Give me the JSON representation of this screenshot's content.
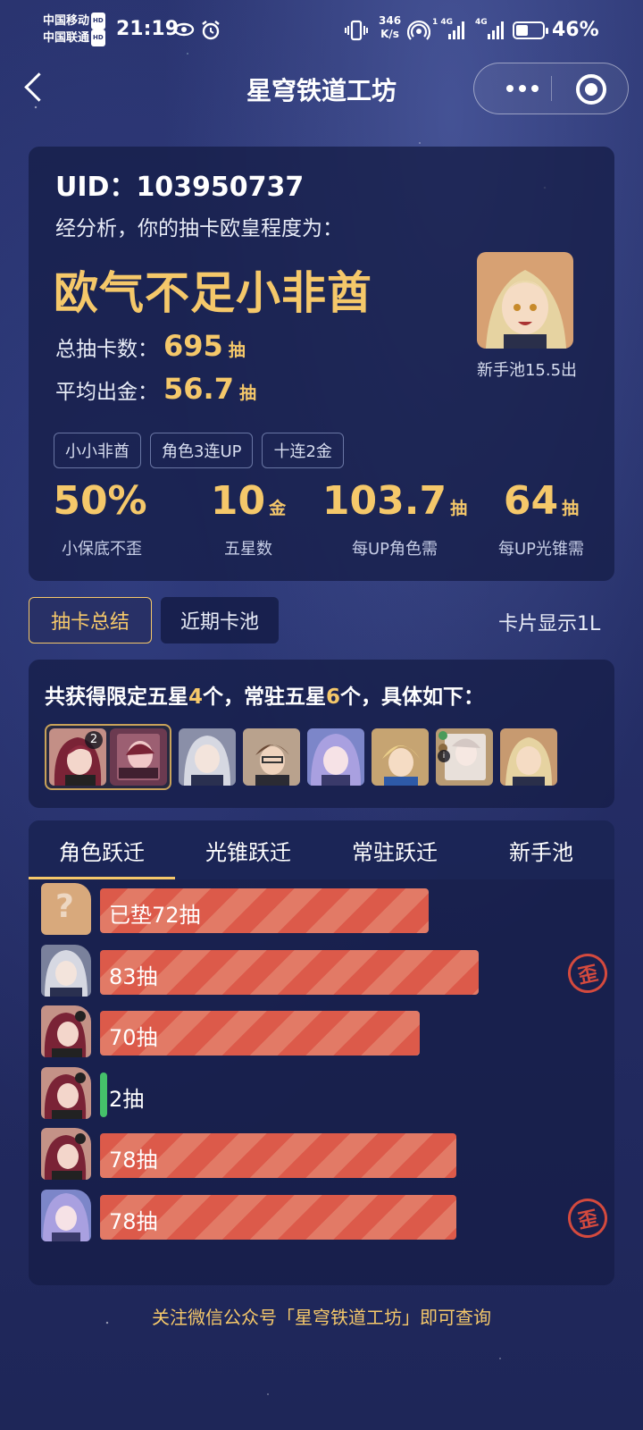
{
  "status_bar": {
    "carrier1": "中国移动",
    "carrier2": "中国联通",
    "hd": "HD",
    "time": "21:19",
    "net_speed_value": "346",
    "net_speed_unit": "K/s",
    "signal1_label": "1 4G",
    "signal2_label": "4G",
    "battery_level": 0.46,
    "battery_pct": "46%"
  },
  "nav": {
    "title": "星穹铁道工坊"
  },
  "summary": {
    "uid_label": "UID：",
    "uid_value": "103950737",
    "analysis": "经分析，你的抽卡欧皇程度为：",
    "verdict": "欧气不足小非酋",
    "total_label": "总抽卡数：",
    "total_value": "695",
    "total_unit": "抽",
    "avg_label": "平均出金：",
    "avg_value": "56.7",
    "avg_unit": "抽",
    "portrait_caption": "新手池15.5出",
    "tags": [
      "小小非酋",
      "角色3连UP",
      "十连2金"
    ],
    "metrics": [
      {
        "value": "50%",
        "unit": "",
        "label": "小保底不歪"
      },
      {
        "value": "10",
        "unit": "金",
        "label": "五星数"
      },
      {
        "value": "103.7",
        "unit": "抽",
        "label": "每UP角色需"
      },
      {
        "value": "64",
        "unit": "抽",
        "label": "每UP光锥需"
      }
    ]
  },
  "tabs": {
    "summary": "抽卡总结",
    "recent": "近期卡池",
    "card_mode": "卡片显示1L"
  },
  "five_star": {
    "text_prefix": "共获得限定五星",
    "limited_count": "4",
    "text_mid": "个，常驻五星",
    "standard_count": "6",
    "text_suffix": "个，具体如下：",
    "duplicate_badge": "2",
    "info_badge": "i"
  },
  "jump": {
    "tabs": [
      "角色跃迁",
      "光锥跃迁",
      "常驻跃迁",
      "新手池"
    ],
    "active_tab": 0,
    "unknown_mark": "?",
    "rows": [
      {
        "label": "已垫72抽",
        "pulls": 72,
        "type": "pity",
        "wai": false
      },
      {
        "label": "83抽",
        "pulls": 83,
        "type": "five_star",
        "wai": true
      },
      {
        "label": "70抽",
        "pulls": 70,
        "type": "five_star",
        "wai": false
      },
      {
        "label": "2抽",
        "pulls": 2,
        "type": "five_star",
        "wai": false
      },
      {
        "label": "78抽",
        "pulls": 78,
        "type": "five_star",
        "wai": false
      },
      {
        "label": "78抽",
        "pulls": 78,
        "type": "five_star",
        "wai": true
      }
    ],
    "wai_label": "歪"
  },
  "footer": "关注微信公众号「星穹铁道工坊」即可查询",
  "colors": {
    "gold": "#f5c86a",
    "bar_red": "#dc5a4a",
    "green": "#45c16a",
    "wai_red": "#d44a3e"
  }
}
